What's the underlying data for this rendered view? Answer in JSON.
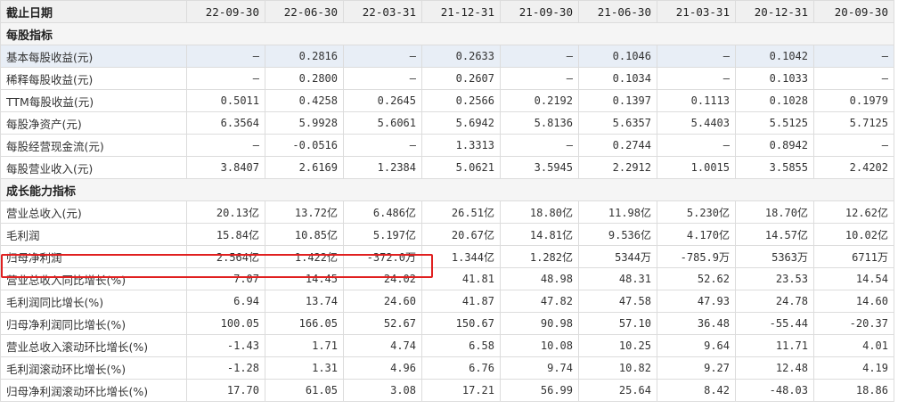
{
  "header": {
    "label": "截止日期",
    "periods": [
      "22-09-30",
      "22-06-30",
      "22-03-31",
      "21-12-31",
      "21-09-30",
      "21-06-30",
      "21-03-31",
      "20-12-31",
      "20-09-30"
    ]
  },
  "sections": [
    {
      "title": "每股指标",
      "rows": [
        {
          "label": "基本每股收益(元)",
          "values": [
            "—",
            "0.2816",
            "—",
            "0.2633",
            "—",
            "0.1046",
            "—",
            "0.1042",
            "—"
          ]
        },
        {
          "label": "稀释每股收益(元)",
          "values": [
            "—",
            "0.2800",
            "—",
            "0.2607",
            "—",
            "0.1034",
            "—",
            "0.1033",
            "—"
          ]
        },
        {
          "label": "TTM每股收益(元)",
          "values": [
            "0.5011",
            "0.4258",
            "0.2645",
            "0.2566",
            "0.2192",
            "0.1397",
            "0.1113",
            "0.1028",
            "0.1979"
          ]
        },
        {
          "label": "每股净资产(元)",
          "values": [
            "6.3564",
            "5.9928",
            "5.6061",
            "5.6942",
            "5.8136",
            "5.6357",
            "5.4403",
            "5.5125",
            "5.7125"
          ]
        },
        {
          "label": "每股经营现金流(元)",
          "values": [
            "—",
            "-0.0516",
            "—",
            "1.3313",
            "—",
            "0.2744",
            "—",
            "0.8942",
            "—"
          ]
        },
        {
          "label": "每股营业收入(元)",
          "values": [
            "3.8407",
            "2.6169",
            "1.2384",
            "5.0621",
            "3.5945",
            "2.2912",
            "1.0015",
            "3.5855",
            "2.4202"
          ]
        }
      ]
    },
    {
      "title": "成长能力指标",
      "rows": [
        {
          "label": "营业总收入(元)",
          "values": [
            "20.13亿",
            "13.72亿",
            "6.486亿",
            "26.51亿",
            "18.80亿",
            "11.98亿",
            "5.230亿",
            "18.70亿",
            "12.62亿"
          ]
        },
        {
          "label": "毛利润",
          "values": [
            "15.84亿",
            "10.85亿",
            "5.197亿",
            "20.67亿",
            "14.81亿",
            "9.536亿",
            "4.170亿",
            "14.57亿",
            "10.02亿"
          ]
        },
        {
          "label": "归母净利润",
          "values": [
            "2.564亿",
            "1.422亿",
            "-372.0万",
            "1.344亿",
            "1.282亿",
            "5344万",
            "-785.9万",
            "5363万",
            "6711万"
          ]
        },
        {
          "label": "营业总收入同比增长(%)",
          "values": [
            "7.07",
            "14.45",
            "24.02",
            "41.81",
            "48.98",
            "48.31",
            "52.62",
            "23.53",
            "14.54"
          ]
        },
        {
          "label": "毛利润同比增长(%)",
          "values": [
            "6.94",
            "13.74",
            "24.60",
            "41.87",
            "47.82",
            "47.58",
            "47.93",
            "24.78",
            "14.60"
          ]
        },
        {
          "label": "归母净利润同比增长(%)",
          "values": [
            "100.05",
            "166.05",
            "52.67",
            "150.67",
            "90.98",
            "57.10",
            "36.48",
            "-55.44",
            "-20.37"
          ]
        },
        {
          "label": "营业总收入滚动环比增长(%)",
          "values": [
            "-1.43",
            "1.71",
            "4.74",
            "6.58",
            "10.08",
            "10.25",
            "9.64",
            "11.71",
            "4.01"
          ]
        },
        {
          "label": "毛利润滚动环比增长(%)",
          "values": [
            "-1.28",
            "1.31",
            "4.96",
            "6.76",
            "9.74",
            "10.82",
            "9.27",
            "12.48",
            "4.19"
          ]
        },
        {
          "label": "归母净利润滚动环比增长(%)",
          "values": [
            "17.70",
            "61.05",
            "3.08",
            "17.21",
            "56.99",
            "25.64",
            "8.42",
            "-48.03",
            "18.86"
          ]
        }
      ]
    }
  ],
  "highlight": {
    "section": 1,
    "row": 2,
    "color": "#e02020"
  }
}
